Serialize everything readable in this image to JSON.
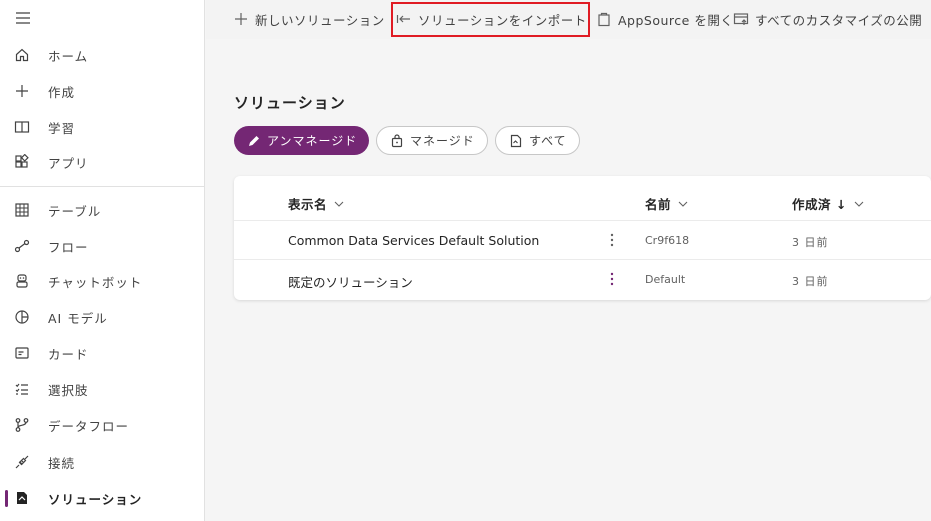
{
  "sidebar": {
    "items": [
      {
        "label": "ホーム",
        "icon": "home-icon"
      },
      {
        "label": "作成",
        "icon": "plus-icon"
      },
      {
        "label": "学習",
        "icon": "book-icon"
      },
      {
        "label": "アプリ",
        "icon": "apps-icon"
      },
      {
        "label": "テーブル",
        "icon": "table-icon"
      },
      {
        "label": "フロー",
        "icon": "flow-icon"
      },
      {
        "label": "チャットボット",
        "icon": "bot-icon"
      },
      {
        "label": "AI モデル",
        "icon": "ai-model-icon"
      },
      {
        "label": "カード",
        "icon": "card-icon"
      },
      {
        "label": "選択肢",
        "icon": "choices-icon"
      },
      {
        "label": "データフロー",
        "icon": "dataflow-icon"
      },
      {
        "label": "接続",
        "icon": "connection-icon"
      },
      {
        "label": "ソリューション",
        "icon": "solution-icon",
        "active": true
      }
    ]
  },
  "cmdbar": {
    "new_solution": "新しいソリューション",
    "import_solution": "ソリューションをインポート",
    "open_appsource": "AppSource を開く",
    "publish_all": "すべてのカスタマイズの公開"
  },
  "main": {
    "title": "ソリューション",
    "filters": [
      {
        "label": "アンマネージド",
        "selected": true
      },
      {
        "label": "マネージド",
        "selected": false
      },
      {
        "label": "すべて",
        "selected": false
      }
    ],
    "table": {
      "columns": {
        "display_name": "表示名",
        "name": "名前",
        "created": "作成済 ↓"
      },
      "rows": [
        {
          "display_name": "Common Data Services Default Solution",
          "name": "Cr9f618",
          "created": "3 日前"
        },
        {
          "display_name": "既定のソリューション",
          "name": "Default",
          "created": "3 日前"
        }
      ]
    }
  },
  "colors": {
    "accent": "#742774",
    "highlight": "#e01b24"
  }
}
